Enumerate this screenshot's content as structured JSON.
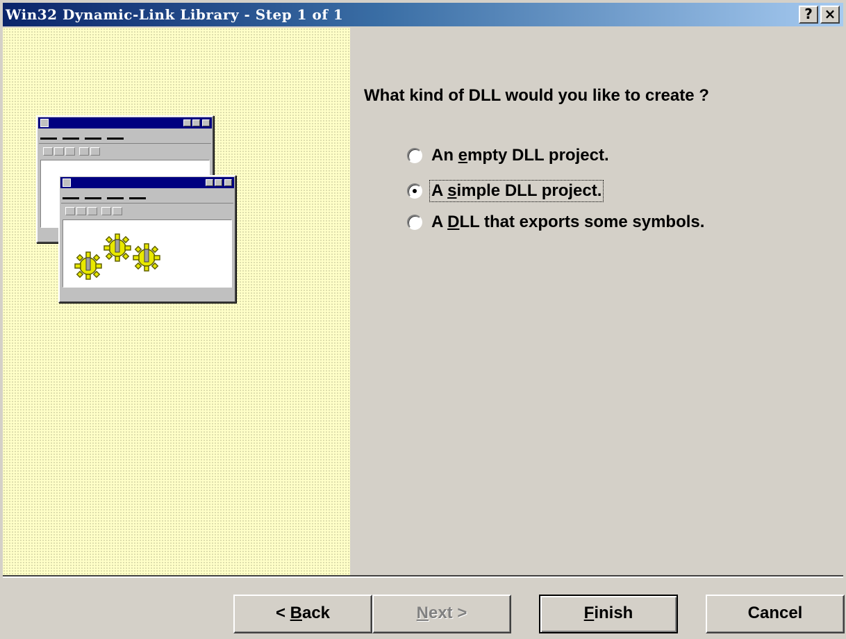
{
  "window": {
    "title": "Win32 Dynamic-Link Library - Step 1 of 1",
    "help_label": "?",
    "close_label": "×"
  },
  "content": {
    "question": "What kind of DLL would you like to create ?",
    "options": [
      {
        "pre": "An ",
        "key": "e",
        "post": "mpty DLL project.",
        "checked": false
      },
      {
        "pre": "A ",
        "key": "s",
        "post": "imple DLL project.",
        "checked": true
      },
      {
        "pre": "A ",
        "key": "D",
        "post": "LL that exports some symbols.",
        "checked": false
      }
    ]
  },
  "buttons": {
    "back": {
      "pre": "< ",
      "key": "B",
      "post": "ack"
    },
    "next": {
      "pre": "",
      "key": "N",
      "post": "ext >",
      "disabled": true
    },
    "finish": {
      "pre": "",
      "key": "F",
      "post": "inish"
    },
    "cancel": {
      "label": "Cancel"
    }
  },
  "illustration": {
    "gear_color": "#e8e800",
    "title_color": "#000080"
  }
}
